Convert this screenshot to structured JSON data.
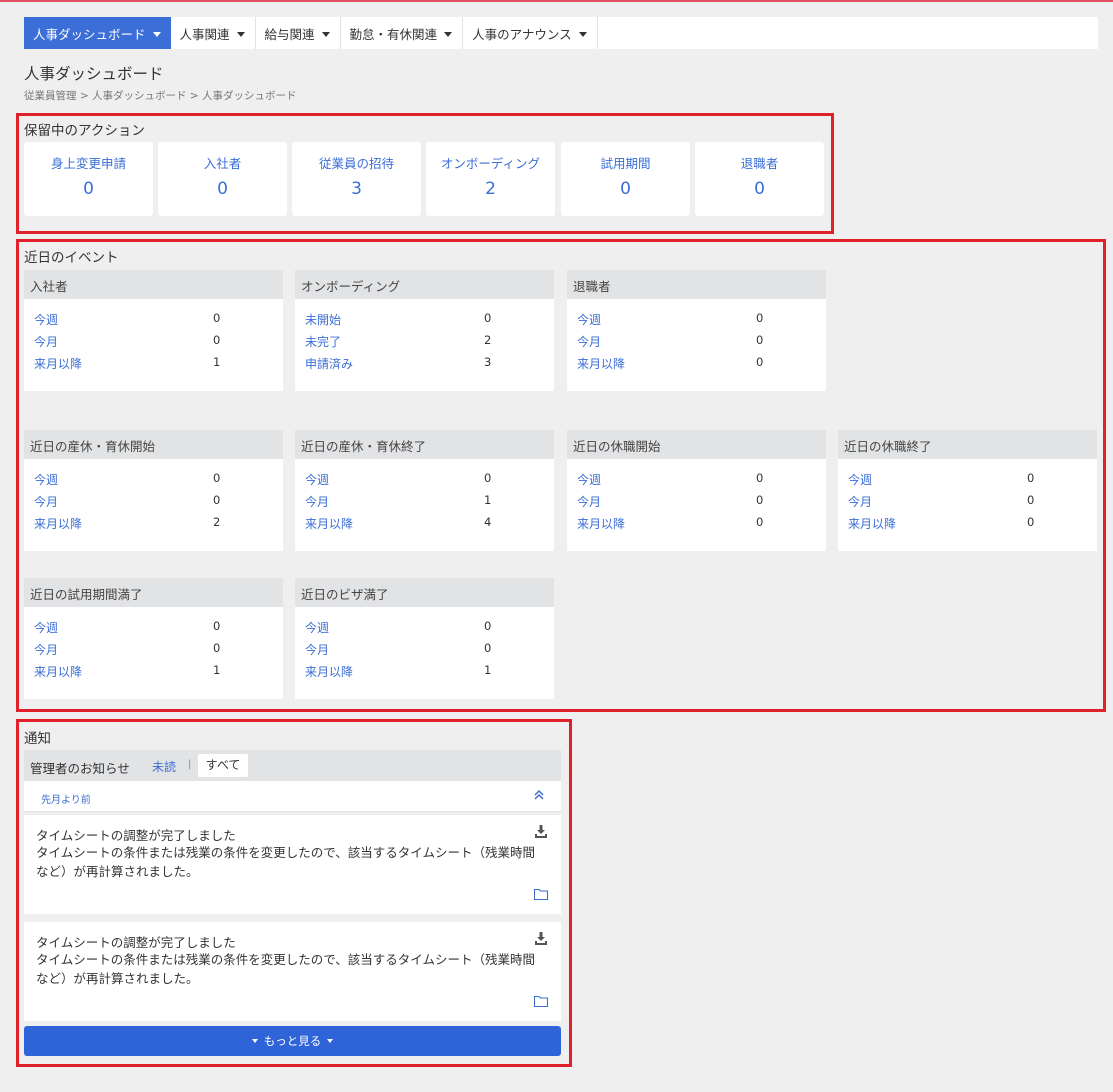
{
  "nav": {
    "items": [
      {
        "label": "人事ダッシュボード",
        "active": true
      },
      {
        "label": "人事関連",
        "active": false
      },
      {
        "label": "給与関連",
        "active": false
      },
      {
        "label": "勤怠・有休関連",
        "active": false
      },
      {
        "label": "人事のアナウンス",
        "active": false
      }
    ]
  },
  "page": {
    "title": "人事ダッシュボード",
    "breadcrumb": "従業員管理 > 人事ダッシュボード > 人事ダッシュボード"
  },
  "pending": {
    "title": "保留中のアクション",
    "cards": [
      {
        "label": "身上変更申請",
        "count": "0"
      },
      {
        "label": "入社者",
        "count": "0"
      },
      {
        "label": "従業員の招待",
        "count": "3"
      },
      {
        "label": "オンボーディング",
        "count": "2"
      },
      {
        "label": "試用期間",
        "count": "0"
      },
      {
        "label": "退職者",
        "count": "0"
      }
    ]
  },
  "events": {
    "title": "近日のイベント",
    "cards": [
      {
        "title": "入社者",
        "rows": [
          {
            "label": "今週",
            "value": "0"
          },
          {
            "label": "今月",
            "value": "0"
          },
          {
            "label": "来月以降",
            "value": "1"
          }
        ]
      },
      {
        "title": "オンボーディング",
        "rows": [
          {
            "label": "未開始",
            "value": "0"
          },
          {
            "label": "未完了",
            "value": "2"
          },
          {
            "label": "申請済み",
            "value": "3"
          }
        ]
      },
      {
        "title": "退職者",
        "rows": [
          {
            "label": "今週",
            "value": "0"
          },
          {
            "label": "今月",
            "value": "0"
          },
          {
            "label": "来月以降",
            "value": "0"
          }
        ]
      },
      {
        "title": "近日の産休・育休開始",
        "rows": [
          {
            "label": "今週",
            "value": "0"
          },
          {
            "label": "今月",
            "value": "0"
          },
          {
            "label": "来月以降",
            "value": "2"
          }
        ]
      },
      {
        "title": "近日の産休・育休終了",
        "rows": [
          {
            "label": "今週",
            "value": "0"
          },
          {
            "label": "今月",
            "value": "1"
          },
          {
            "label": "来月以降",
            "value": "4"
          }
        ]
      },
      {
        "title": "近日の休職開始",
        "rows": [
          {
            "label": "今週",
            "value": "0"
          },
          {
            "label": "今月",
            "value": "0"
          },
          {
            "label": "来月以降",
            "value": "0"
          }
        ]
      },
      {
        "title": "近日の休職終了",
        "rows": [
          {
            "label": "今週",
            "value": "0"
          },
          {
            "label": "今月",
            "value": "0"
          },
          {
            "label": "来月以降",
            "value": "0"
          }
        ]
      },
      {
        "title": "近日の試用期間満了",
        "rows": [
          {
            "label": "今週",
            "value": "0"
          },
          {
            "label": "今月",
            "value": "0"
          },
          {
            "label": "来月以降",
            "value": "1"
          }
        ]
      },
      {
        "title": "近日のビザ満了",
        "rows": [
          {
            "label": "今週",
            "value": "0"
          },
          {
            "label": "今月",
            "value": "0"
          },
          {
            "label": "来月以降",
            "value": "1"
          }
        ]
      }
    ]
  },
  "notifications": {
    "title": "通知",
    "header": "管理者のお知らせ",
    "tab_unread": "未読",
    "tab_sep": "|",
    "tab_all": "すべて",
    "older_label": "先月より前",
    "items": [
      {
        "title": "タイムシートの調整が完了しました",
        "body": "タイムシートの条件または残業の条件を変更したので、該当するタイムシート（残業時間など）が再計算されました。"
      },
      {
        "title": "タイムシートの調整が完了しました",
        "body": "タイムシートの条件または残業の条件を変更したので、該当するタイムシート（残業時間など）が再計算されました。"
      }
    ],
    "more_label": "もっと見る"
  },
  "colors": {
    "accent": "#3b6ed6",
    "highlight": "#e0202a",
    "button": "#2f63d8"
  }
}
